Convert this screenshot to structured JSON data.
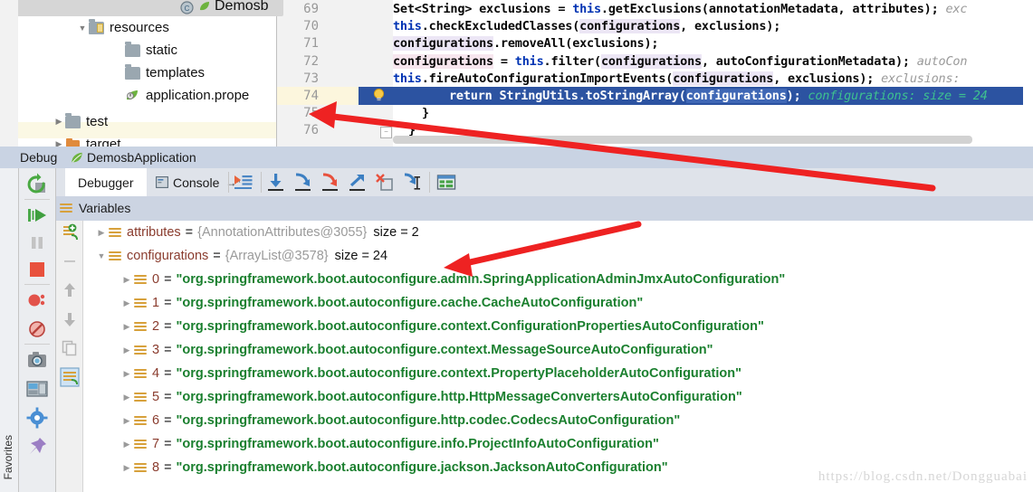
{
  "window": {
    "editor_tab_label": "Demosb"
  },
  "project_tree": {
    "items": [
      {
        "label": "resources",
        "icon": "resources-folder-icon",
        "twisty": "▼",
        "indent": 78
      },
      {
        "label": "static",
        "icon": "folder-icon",
        "twisty": "",
        "indent": 118
      },
      {
        "label": "templates",
        "icon": "folder-icon",
        "twisty": "",
        "indent": 118
      },
      {
        "label": "application.prope",
        "icon": "spring-properties-icon",
        "twisty": "",
        "indent": 118
      },
      {
        "label": "test",
        "icon": "folder-icon",
        "twisty": "▶",
        "indent": 52
      },
      {
        "label": "target",
        "icon": "target-folder-icon",
        "twisty": "▶",
        "indent": 52
      }
    ]
  },
  "editor": {
    "line_numbers": [
      "69",
      "70",
      "71",
      "72",
      "73",
      "74",
      "75",
      "76"
    ],
    "lines": [
      {
        "n": "69",
        "parts": [
          {
            "t": "Set<String> exclusions = ",
            "c": "txt"
          },
          {
            "t": "this",
            "c": "kw"
          },
          {
            "t": ".getExclusions(annotationMetadata, attributes);",
            "c": "txt"
          }
        ],
        "hint": "exc"
      },
      {
        "n": "70",
        "parts": [
          {
            "t": "this",
            "c": "kw"
          },
          {
            "t": ".checkExcludedClasses(",
            "c": "txt"
          },
          {
            "t": "configurations",
            "c": "fld"
          },
          {
            "t": ", exclusions);",
            "c": "txt"
          }
        ],
        "hint": ""
      },
      {
        "n": "71",
        "parts": [
          {
            "t": "configurations",
            "c": "fld"
          },
          {
            "t": ".removeAll(exclusions);",
            "c": "txt"
          }
        ],
        "hint": ""
      },
      {
        "n": "72",
        "parts": [
          {
            "t": "configurations",
            "c": "fld2"
          },
          {
            "t": " = ",
            "c": "txt"
          },
          {
            "t": "this",
            "c": "kw"
          },
          {
            "t": ".filter(",
            "c": "txt"
          },
          {
            "t": "configurations",
            "c": "fld"
          },
          {
            "t": ", autoConfigurationMetadata);",
            "c": "txt"
          }
        ],
        "hint": "autoCon"
      },
      {
        "n": "73",
        "parts": [
          {
            "t": "this",
            "c": "kw"
          },
          {
            "t": ".fireAutoConfigurationImportEvents(",
            "c": "txt"
          },
          {
            "t": "configurations",
            "c": "fld"
          },
          {
            "t": ", exclusions);",
            "c": "txt"
          }
        ],
        "hint": "exclusions:"
      },
      {
        "n": "74",
        "parts": [
          {
            "t": "return",
            "c": "kwwhite"
          },
          {
            "t": " StringUtils.toStringArray(",
            "c": "white"
          },
          {
            "t": "configurations",
            "c": "whitefld"
          },
          {
            "t": ");",
            "c": "white"
          }
        ],
        "hint_green": "configurations:   size = 24",
        "highlighted": true,
        "has_bulb": true
      },
      {
        "n": "75",
        "parts": [
          {
            "t": "}",
            "c": "txt"
          }
        ],
        "hint": ""
      },
      {
        "n": "76",
        "parts": [
          {
            "t": "}",
            "c": "txt"
          }
        ],
        "hint": ""
      }
    ]
  },
  "debug_panel": {
    "title": "Debug",
    "app_name": "DemosbApplication",
    "favorites_label": "Favorites",
    "tabs": [
      {
        "label": "Debugger",
        "icon": "debugger-icon",
        "active": true
      },
      {
        "label": "Console",
        "icon": "console-icon",
        "active": false
      }
    ],
    "console_suffix": "→*",
    "toolbar_buttons": [
      {
        "name": "show-execution-point-icon"
      },
      {
        "name": "step-over-icon"
      },
      {
        "name": "step-into-icon"
      },
      {
        "name": "force-step-into-icon"
      },
      {
        "name": "step-out-icon"
      },
      {
        "name": "drop-frame-icon"
      },
      {
        "name": "run-to-cursor-icon"
      },
      {
        "name": "evaluate-expression-icon"
      }
    ],
    "sidebar_buttons": [
      {
        "name": "rerun-icon"
      },
      {
        "name": "resume-program-icon"
      },
      {
        "name": "pause-program-icon"
      },
      {
        "name": "stop-icon"
      },
      {
        "name": "view-breakpoints-icon"
      },
      {
        "name": "mute-breakpoints-icon"
      },
      {
        "name": "get-thread-dump-icon"
      },
      {
        "name": "restore-layout-icon"
      },
      {
        "name": "settings-icon"
      },
      {
        "name": "pin-tab-icon"
      }
    ],
    "variables_panel": {
      "header": "Variables",
      "gutter_buttons": [
        {
          "name": "add-watch-icon"
        },
        {
          "name": "remove-watch-icon"
        },
        {
          "name": "move-up-icon"
        },
        {
          "name": "move-down-icon"
        },
        {
          "name": "copy-value-icon"
        },
        {
          "name": "inspect-icon"
        }
      ],
      "rows": [
        {
          "kind": "var",
          "twisty": "▶",
          "name": "attributes",
          "eq": "=",
          "type": "{AnnotationAttributes@3055}",
          "size": "size = 2",
          "indent": 60
        },
        {
          "kind": "var",
          "twisty": "▼",
          "name": "configurations",
          "eq": "=",
          "type": "{ArrayList@3578}",
          "size": "size = 24",
          "indent": 60
        },
        {
          "kind": "item",
          "twisty": "▶",
          "index": "0",
          "eq": "=",
          "value": "\"org.springframework.boot.autoconfigure.admin.SpringApplicationAdminJmxAutoConfiguration\"",
          "indent": 88
        },
        {
          "kind": "item",
          "twisty": "▶",
          "index": "1",
          "eq": "=",
          "value": "\"org.springframework.boot.autoconfigure.cache.CacheAutoConfiguration\"",
          "indent": 88
        },
        {
          "kind": "item",
          "twisty": "▶",
          "index": "2",
          "eq": "=",
          "value": "\"org.springframework.boot.autoconfigure.context.ConfigurationPropertiesAutoConfiguration\"",
          "indent": 88
        },
        {
          "kind": "item",
          "twisty": "▶",
          "index": "3",
          "eq": "=",
          "value": "\"org.springframework.boot.autoconfigure.context.MessageSourceAutoConfiguration\"",
          "indent": 88
        },
        {
          "kind": "item",
          "twisty": "▶",
          "index": "4",
          "eq": "=",
          "value": "\"org.springframework.boot.autoconfigure.context.PropertyPlaceholderAutoConfiguration\"",
          "indent": 88
        },
        {
          "kind": "item",
          "twisty": "▶",
          "index": "5",
          "eq": "=",
          "value": "\"org.springframework.boot.autoconfigure.http.HttpMessageConvertersAutoConfiguration\"",
          "indent": 88
        },
        {
          "kind": "item",
          "twisty": "▶",
          "index": "6",
          "eq": "=",
          "value": "\"org.springframework.boot.autoconfigure.http.codec.CodecsAutoConfiguration\"",
          "indent": 88
        },
        {
          "kind": "item",
          "twisty": "▶",
          "index": "7",
          "eq": "=",
          "value": "\"org.springframework.boot.autoconfigure.info.ProjectInfoAutoConfiguration\"",
          "indent": 88
        },
        {
          "kind": "item",
          "twisty": "▶",
          "index": "8",
          "eq": "=",
          "value": "\"org.springframework.boot.autoconfigure.jackson.JacksonAutoConfiguration\"",
          "indent": 88
        }
      ]
    }
  },
  "watermark": "https://blog.csdn.net/Dongguabai",
  "annotations": {
    "arrow_color": "#ee2222",
    "arrows": [
      {
        "name": "annotation-arrow-to-inline-hint"
      },
      {
        "name": "annotation-arrow-to-configurations-size"
      }
    ]
  },
  "colors": {
    "selection_blue": "#2c53a1",
    "debug_title_bg": "#c9d3e3",
    "string_green": "#1a7f2e",
    "keyword_blue": "#0033b3",
    "var_name_red": "#8a3c2e"
  }
}
